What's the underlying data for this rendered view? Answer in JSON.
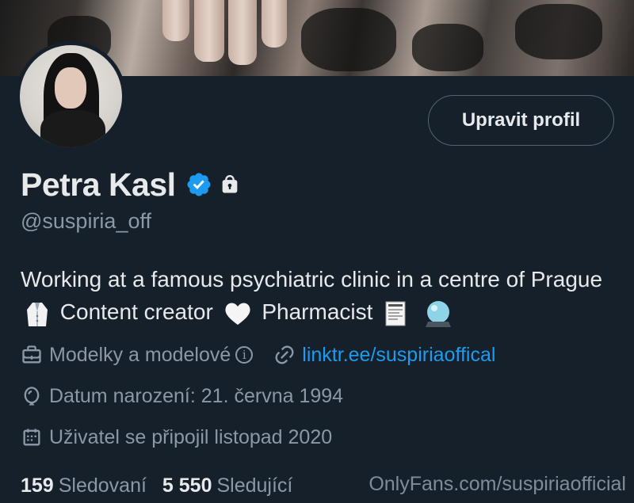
{
  "profile": {
    "edit_button": "Upravit profil",
    "name": "Petra Kasl",
    "handle": "@suspiria_off",
    "bio_part1": "Working at a famous psychiatric clinic in a centre of Prague",
    "bio_part2": "Content creator",
    "bio_part3": "Pharmacist",
    "category": "Modelky a modelové",
    "category_info": "i",
    "link": "linktr.ee/suspiriaoffical",
    "birthday": "Datum narození: 21. června 1994",
    "joined": "Uživatel se připojil listopad 2020",
    "following_count": "159",
    "following_label": "Sledovaní",
    "followers_count": "5 550",
    "followers_label": "Sledující"
  },
  "watermark": "OnlyFans.com/suspiriaofficial",
  "icons": [
    "verified-badge-icon",
    "lock-icon",
    "briefcase-icon",
    "info-icon",
    "link-icon",
    "balloon-icon",
    "calendar-icon",
    "lab-coat-emoji",
    "white-heart-emoji",
    "receipt-emoji",
    "crystal-ball-emoji"
  ],
  "colors": {
    "background": "#15202b",
    "text": "#e7e9ea",
    "secondary": "#8b98a5",
    "link": "#1d9bf0",
    "verified": "#1d9bf0"
  }
}
